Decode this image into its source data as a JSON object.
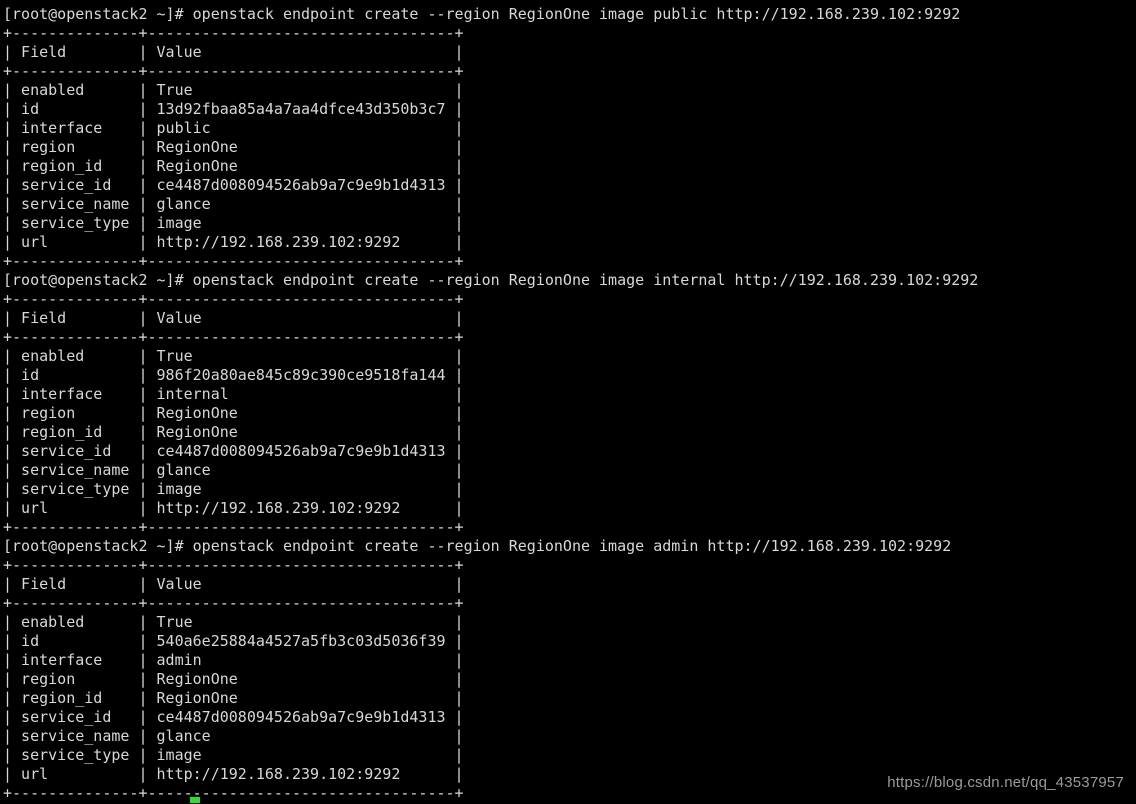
{
  "terminal": {
    "background_color": "#000000",
    "foreground_color": "#d4d4d4",
    "cursor_color": "#2ee02e",
    "prompt": "[root@openstack2 ~]#",
    "separator": "+--------------+----------------------------------+",
    "header_row": "| Field        | Value                            |",
    "partial_top_line": "+--------------+----------------------------------+",
    "commands": {
      "public": "[root@openstack2 ~]# openstack endpoint create --region RegionOne image public http://192.168.239.102:9292",
      "internal": "[root@openstack2 ~]# openstack endpoint create --region RegionOne image internal http://192.168.239.102:9292",
      "admin": "[root@openstack2 ~]# openstack endpoint create --region RegionOne image admin http://192.168.239.102:9292"
    },
    "blocks": [
      {
        "id": "endpoint-public",
        "command": "[root@openstack2 ~]# openstack endpoint create --region RegionOne image public http://192.168.239.102:9292",
        "columns": [
          "Field",
          "Value"
        ],
        "rows": [
          [
            "enabled",
            "True"
          ],
          [
            "id",
            "13d92fbaa85a4a7aa4dfce43d350b3c7"
          ],
          [
            "interface",
            "public"
          ],
          [
            "region",
            "RegionOne"
          ],
          [
            "region_id",
            "RegionOne"
          ],
          [
            "service_id",
            "ce4487d008094526ab9a7c9e9b1d4313"
          ],
          [
            "service_name",
            "glance"
          ],
          [
            "service_type",
            "image"
          ],
          [
            "url",
            "http://192.168.239.102:9292"
          ]
        ]
      },
      {
        "id": "endpoint-internal",
        "command": "[root@openstack2 ~]# openstack endpoint create --region RegionOne image internal http://192.168.239.102:9292",
        "columns": [
          "Field",
          "Value"
        ],
        "rows": [
          [
            "enabled",
            "True"
          ],
          [
            "id",
            "986f20a80ae845c89c390ce9518fa144"
          ],
          [
            "interface",
            "internal"
          ],
          [
            "region",
            "RegionOne"
          ],
          [
            "region_id",
            "RegionOne"
          ],
          [
            "service_id",
            "ce4487d008094526ab9a7c9e9b1d4313"
          ],
          [
            "service_name",
            "glance"
          ],
          [
            "service_type",
            "image"
          ],
          [
            "url",
            "http://192.168.239.102:9292"
          ]
        ]
      },
      {
        "id": "endpoint-admin",
        "command": "[root@openstack2 ~]# openstack endpoint create --region RegionOne image admin http://192.168.239.102:9292",
        "columns": [
          "Field",
          "Value"
        ],
        "rows": [
          [
            "enabled",
            "True"
          ],
          [
            "id",
            "540a6e25884a4527a5fb3c03d5036f39"
          ],
          [
            "interface",
            "admin"
          ],
          [
            "region",
            "RegionOne"
          ],
          [
            "region_id",
            "RegionOne"
          ],
          [
            "service_id",
            "ce4487d008094526ab9a7c9e9b1d4313"
          ],
          [
            "service_name",
            "glance"
          ],
          [
            "service_type",
            "image"
          ],
          [
            "url",
            "http://192.168.239.102:9292"
          ]
        ]
      }
    ],
    "lines": [
      "+--------------+----------------------------------+",
      "[root@openstack2 ~]# openstack endpoint create --region RegionOne image public http://192.168.239.102:9292",
      "+--------------+----------------------------------+",
      "| Field        | Value                            |",
      "+--------------+----------------------------------+",
      "| enabled      | True                             |",
      "| id           | 13d92fbaa85a4a7aa4dfce43d350b3c7 |",
      "| interface    | public                           |",
      "| region       | RegionOne                        |",
      "| region_id    | RegionOne                        |",
      "| service_id   | ce4487d008094526ab9a7c9e9b1d4313 |",
      "| service_name | glance                           |",
      "| service_type | image                            |",
      "| url          | http://192.168.239.102:9292      |",
      "+--------------+----------------------------------+",
      "[root@openstack2 ~]# openstack endpoint create --region RegionOne image internal http://192.168.239.102:9292",
      "+--------------+----------------------------------+",
      "| Field        | Value                            |",
      "+--------------+----------------------------------+",
      "| enabled      | True                             |",
      "| id           | 986f20a80ae845c89c390ce9518fa144 |",
      "| interface    | internal                         |",
      "| region       | RegionOne                        |",
      "| region_id    | RegionOne                        |",
      "| service_id   | ce4487d008094526ab9a7c9e9b1d4313 |",
      "| service_name | glance                           |",
      "| service_type | image                            |",
      "| url          | http://192.168.239.102:9292      |",
      "+--------------+----------------------------------+",
      "[root@openstack2 ~]# openstack endpoint create --region RegionOne image admin http://192.168.239.102:9292",
      "+--------------+----------------------------------+",
      "| Field        | Value                            |",
      "+--------------+----------------------------------+",
      "| enabled      | True                             |",
      "| id           | 540a6e25884a4527a5fb3c03d5036f39 |",
      "| interface    | admin                            |",
      "| region       | RegionOne                        |",
      "| region_id    | RegionOne                        |",
      "| service_id   | ce4487d008094526ab9a7c9e9b1d4313 |",
      "| service_name | glance                           |",
      "| service_type | image                            |",
      "| url          | http://192.168.239.102:9292      |",
      "+--------------+----------------------------------+"
    ]
  },
  "watermark": {
    "text": "https://blog.csdn.net/qq_43537957"
  }
}
